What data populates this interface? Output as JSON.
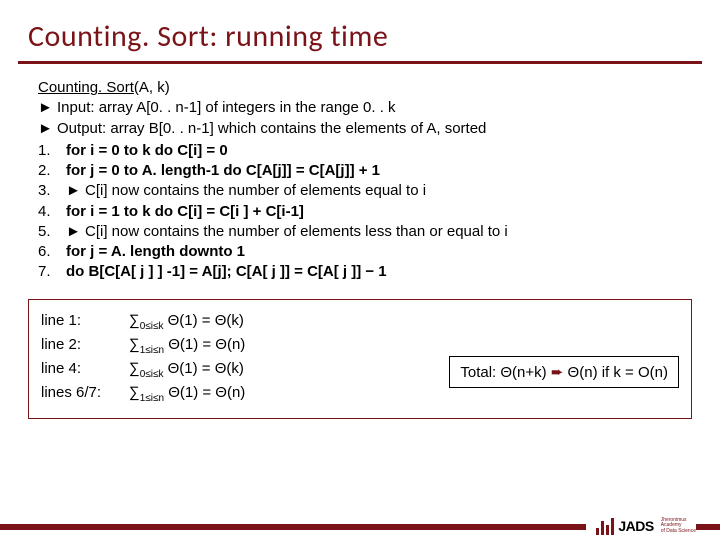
{
  "title": "Counting. Sort: running time",
  "algo": {
    "name_part1": "Counting. Sort",
    "name_part2": "(A, k)",
    "comment1": "► Input: array A[0. . n-1] of integers in the range 0. . k",
    "comment2": "► Output: array B[0. . n-1] which contains the elements of A, sorted",
    "lines": [
      {
        "n": "1.",
        "t": "for  i = 0  to  k  do  C[i] = 0"
      },
      {
        "n": "2.",
        "t": "for  j = 0  to  A. length-1 do  C[A[j]] = C[A[j]] + 1"
      },
      {
        "n": "3.",
        "t": "  ► C[i] now contains the number of elements equal to i"
      },
      {
        "n": "4.",
        "t": "for  i = 1  to  k  do  C[i] = C[i ] + C[i-1]"
      },
      {
        "n": "5.",
        "t": "  ► C[i] now contains the number of elements less than or equal to i"
      },
      {
        "n": "6.",
        "t": "for  j = A. length downto  1"
      },
      {
        "n": "7.",
        "t": "       do  B[C[A[ j ] ] -1] =  A[j];  C[A[ j ]] = C[A[ j ]] − 1"
      }
    ]
  },
  "analysis": {
    "rows": [
      {
        "label": "line 1:",
        "sub": "0≤i≤k",
        "rhs": " Θ(1)  = Θ(k)"
      },
      {
        "label": "line 2:",
        "sub": "1≤i≤n",
        "rhs": " Θ(1)  = Θ(n)"
      },
      {
        "label": "line 4:",
        "sub": "0≤i≤k",
        "rhs": " Θ(1)  = Θ(k)"
      },
      {
        "label": "lines 6/7:",
        "sub": "1≤i≤n",
        "rhs": " Θ(1)  = Θ(n)"
      }
    ],
    "total_prefix": "Total: Θ(n+k) ",
    "total_suffix": " Θ(n) if  k = O(n)"
  },
  "logo": {
    "letters": "JADS",
    "small1": "Jheronimus",
    "small2": "Academy",
    "small3": "of Data Science"
  }
}
